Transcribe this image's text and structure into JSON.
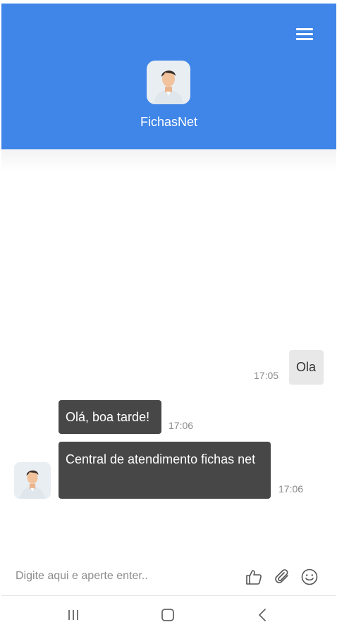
{
  "header": {
    "title": "FichasNet",
    "background": "#3f86e8",
    "menu_icon": "hamburger-menu-icon",
    "avatar_icon": "user-avatar-icon"
  },
  "messages": [
    {
      "from": "user",
      "text": "Ola",
      "time": "17:05"
    },
    {
      "from": "bot",
      "text": "Olá, boa tarde!",
      "time": "17:06"
    },
    {
      "from": "bot",
      "text": "Central de atendimento fichas net",
      "time": "17:06"
    }
  ],
  "composer": {
    "placeholder": "Digite aqui e aperte enter..",
    "icons": [
      "thumbs-up-icon",
      "paperclip-icon",
      "smiley-icon"
    ]
  },
  "system_nav": {
    "icons": [
      "recent-apps-icon",
      "home-icon",
      "back-icon"
    ]
  },
  "colors": {
    "bot_bubble": "#474747",
    "user_bubble": "#e8e8e8"
  }
}
